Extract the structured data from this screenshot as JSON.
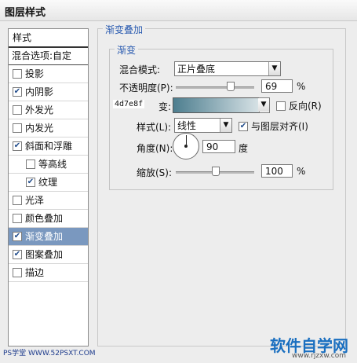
{
  "window": {
    "title": "图层样式"
  },
  "sidebar": {
    "header": "样式",
    "blend_options": "混合选项:自定",
    "items": [
      {
        "label": "投影",
        "checked": false
      },
      {
        "label": "内阴影",
        "checked": true
      },
      {
        "label": "外发光",
        "checked": false
      },
      {
        "label": "内发光",
        "checked": false
      },
      {
        "label": "斜面和浮雕",
        "checked": true
      },
      {
        "label": "等高线",
        "checked": false
      },
      {
        "label": "纹理",
        "checked": true
      },
      {
        "label": "光泽",
        "checked": false
      },
      {
        "label": "颜色叠加",
        "checked": false
      },
      {
        "label": "渐变叠加",
        "checked": true
      },
      {
        "label": "图案叠加",
        "checked": true
      },
      {
        "label": "描边",
        "checked": false
      }
    ],
    "selected": "渐变叠加"
  },
  "panel": {
    "group_title": "渐变叠加",
    "sub_title": "渐变",
    "blend_mode": {
      "label": "混合模式:",
      "value": "正片叠底"
    },
    "opacity": {
      "label": "不透明度(P):",
      "value": "69",
      "unit": "%",
      "level": 0.69
    },
    "gradient": {
      "label": "4d7e8f",
      "suffix": "变:",
      "start_color": "#4d7e8f",
      "end_color": "#e8eef0",
      "reverse_label": "反向(R)"
    },
    "style": {
      "label": "样式(L):",
      "value": "线性",
      "align_label": "与图层对齐(I)"
    },
    "angle": {
      "label": "角度(N):",
      "value": "90",
      "unit": "度"
    },
    "scale": {
      "label": "缩放(S):",
      "value": "100",
      "unit": "%",
      "level": 0.5
    }
  },
  "watermark": {
    "left": "PS学堂",
    "left_url": "WWW.52PSXT.COM",
    "right": "软件自学网",
    "right_url": "www.rjzxw.com"
  }
}
